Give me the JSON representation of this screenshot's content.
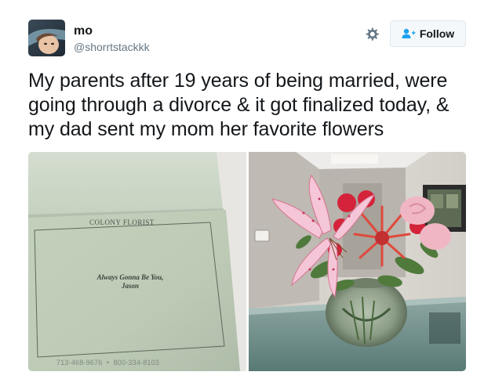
{
  "tweet": {
    "user": {
      "name": "mo",
      "handle": "@shorrtstackkk"
    },
    "follow_label": "Follow",
    "text_lines": [
      "My parents after 19 years of being married, were",
      "going through a divorce & it got finalized today, &",
      "my dad sent my mom her favorite flowers"
    ],
    "photos": {
      "card": {
        "florist_name": "Colony Florist",
        "message_line1": "Always Gonna Be You,",
        "message_line2": "Jason",
        "phones": "713-468-9676  •  800-334-8103"
      }
    }
  },
  "colors": {
    "text": "#14171a",
    "secondary": "#657786",
    "follow_bg": "#f5f8fa",
    "follow_icon": "#1da1f2",
    "card_green": "#c9d6c3"
  },
  "icons": {
    "settings": "gear-icon",
    "follow": "follow-person-plus-icon"
  }
}
